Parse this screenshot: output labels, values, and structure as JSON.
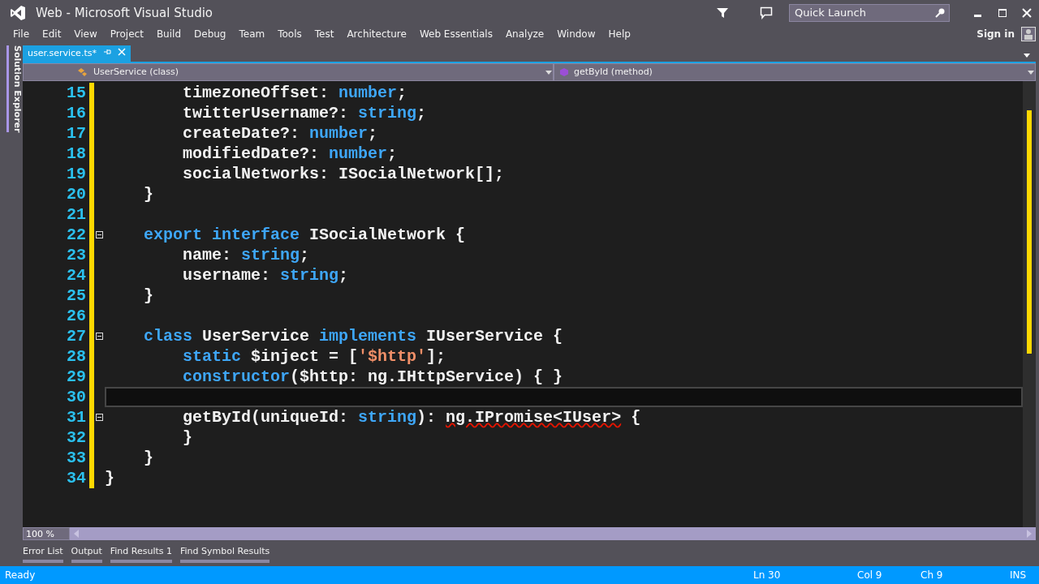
{
  "window": {
    "title": "Web - Microsoft Visual Studio"
  },
  "quick_launch": {
    "placeholder": "Quick Launch"
  },
  "menu": [
    "File",
    "Edit",
    "View",
    "Project",
    "Build",
    "Debug",
    "Team",
    "Tools",
    "Test",
    "Architecture",
    "Web Essentials",
    "Analyze",
    "Window",
    "Help"
  ],
  "sign_in": "Sign in",
  "side_tab": "Solution Explorer",
  "document_tabs": [
    {
      "label": "user.service.ts*",
      "selected": true
    }
  ],
  "nav_bar": {
    "type_scope": "UserService (class)",
    "member_scope": "getById (method)"
  },
  "editor": {
    "lines": [
      {
        "number": "15",
        "tokens": [
          {
            "text": "        timezoneOffset: ",
            "kind": "plain"
          },
          {
            "text": "number",
            "kind": "keyword"
          },
          {
            "text": ";",
            "kind": "plain"
          }
        ]
      },
      {
        "number": "16",
        "tokens": [
          {
            "text": "        twitterUsername?: ",
            "kind": "plain"
          },
          {
            "text": "string",
            "kind": "keyword"
          },
          {
            "text": ";",
            "kind": "plain"
          }
        ]
      },
      {
        "number": "17",
        "tokens": [
          {
            "text": "        createDate?: ",
            "kind": "plain"
          },
          {
            "text": "number",
            "kind": "keyword"
          },
          {
            "text": ";",
            "kind": "plain"
          }
        ]
      },
      {
        "number": "18",
        "tokens": [
          {
            "text": "        modifiedDate?: ",
            "kind": "plain"
          },
          {
            "text": "number",
            "kind": "keyword"
          },
          {
            "text": ";",
            "kind": "plain"
          }
        ]
      },
      {
        "number": "19",
        "tokens": [
          {
            "text": "        socialNetworks: ISocialNetwork[];",
            "kind": "plain"
          }
        ]
      },
      {
        "number": "20",
        "tokens": [
          {
            "text": "    }",
            "kind": "plain"
          }
        ]
      },
      {
        "number": "21"
      },
      {
        "number": "22",
        "fold": true,
        "tokens": [
          {
            "text": "    export",
            "kind": "keyword"
          },
          {
            "text": " interface",
            "kind": "keyword"
          },
          {
            "text": " ISocialNetwork {",
            "kind": "plain"
          }
        ]
      },
      {
        "number": "23",
        "tokens": [
          {
            "text": "        name: ",
            "kind": "plain"
          },
          {
            "text": "string",
            "kind": "keyword"
          },
          {
            "text": ";",
            "kind": "plain"
          }
        ]
      },
      {
        "number": "24",
        "tokens": [
          {
            "text": "        username: ",
            "kind": "plain"
          },
          {
            "text": "string",
            "kind": "keyword"
          },
          {
            "text": ";",
            "kind": "plain"
          }
        ]
      },
      {
        "number": "25",
        "tokens": [
          {
            "text": "    }",
            "kind": "plain"
          }
        ]
      },
      {
        "number": "26"
      },
      {
        "number": "27",
        "fold": true,
        "tokens": [
          {
            "text": "    class",
            "kind": "keyword"
          },
          {
            "text": " UserService ",
            "kind": "plain"
          },
          {
            "text": "implements",
            "kind": "keyword"
          },
          {
            "text": " IUserService {",
            "kind": "plain"
          }
        ]
      },
      {
        "number": "28",
        "tokens": [
          {
            "text": "        static",
            "kind": "keyword"
          },
          {
            "text": " $inject = [",
            "kind": "plain"
          },
          {
            "text": "'$http'",
            "kind": "string"
          },
          {
            "text": "];",
            "kind": "plain"
          }
        ]
      },
      {
        "number": "29",
        "tokens": [
          {
            "text": "        constructor",
            "kind": "keyword"
          },
          {
            "text": "($http: ng.IHttpService) { }",
            "kind": "plain"
          }
        ]
      },
      {
        "number": "30",
        "current": true
      },
      {
        "number": "31",
        "fold": true,
        "tokens": [
          {
            "text": "        getById(uniqueId: ",
            "kind": "plain"
          },
          {
            "text": "string",
            "kind": "keyword"
          },
          {
            "text": "): ",
            "kind": "plain"
          },
          {
            "text": "ng.IPromise<IUser>",
            "kind": "error"
          },
          {
            "text": " {",
            "kind": "plain"
          }
        ]
      },
      {
        "number": "32",
        "tokens": [
          {
            "text": "        }",
            "kind": "plain"
          }
        ]
      },
      {
        "number": "33",
        "tokens": [
          {
            "text": "    }",
            "kind": "plain"
          }
        ]
      },
      {
        "number": "34",
        "tokens": [
          {
            "text": "}",
            "kind": "plain"
          }
        ]
      }
    ]
  },
  "zoom": "100 %",
  "tool_tabs": [
    "Error List",
    "Output",
    "Find Results 1",
    "Find Symbol Results"
  ],
  "status_bar": {
    "message": "Ready",
    "line": "Ln 30",
    "column": "Col 9",
    "char": "Ch 9",
    "mode": "INS"
  }
}
